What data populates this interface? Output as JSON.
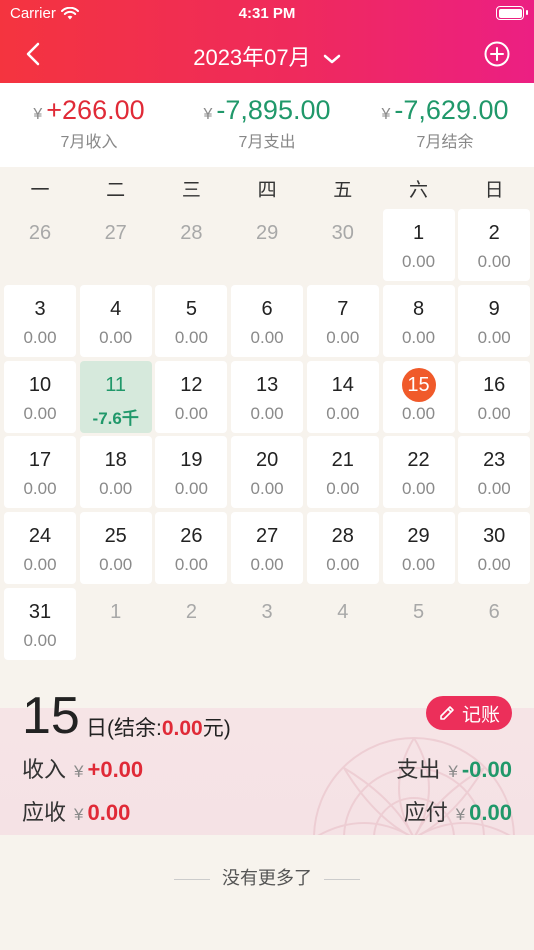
{
  "status_bar": {
    "carrier": "Carrier",
    "time": "4:31 PM"
  },
  "nav": {
    "title": "2023年07月"
  },
  "summary": {
    "currency": "¥",
    "income": {
      "value": "+266.00",
      "label": "7月收入"
    },
    "expense": {
      "value": "-7,895.00",
      "label": "7月支出"
    },
    "balance": {
      "value": "-7,629.00",
      "label": "7月结余"
    }
  },
  "calendar": {
    "weekdays": [
      "一",
      "二",
      "三",
      "四",
      "五",
      "六",
      "日"
    ],
    "days": [
      {
        "num": "26",
        "amt": "",
        "type": "other"
      },
      {
        "num": "27",
        "amt": "",
        "type": "other"
      },
      {
        "num": "28",
        "amt": "",
        "type": "other"
      },
      {
        "num": "29",
        "amt": "",
        "type": "other"
      },
      {
        "num": "30",
        "amt": "",
        "type": "other"
      },
      {
        "num": "1",
        "amt": "0.00",
        "type": "cur"
      },
      {
        "num": "2",
        "amt": "0.00",
        "type": "cur"
      },
      {
        "num": "3",
        "amt": "0.00",
        "type": "cur"
      },
      {
        "num": "4",
        "amt": "0.00",
        "type": "cur"
      },
      {
        "num": "5",
        "amt": "0.00",
        "type": "cur"
      },
      {
        "num": "6",
        "amt": "0.00",
        "type": "cur"
      },
      {
        "num": "7",
        "amt": "0.00",
        "type": "cur"
      },
      {
        "num": "8",
        "amt": "0.00",
        "type": "cur"
      },
      {
        "num": "9",
        "amt": "0.00",
        "type": "cur"
      },
      {
        "num": "10",
        "amt": "0.00",
        "type": "cur"
      },
      {
        "num": "11",
        "amt": "-7.6千",
        "type": "neg"
      },
      {
        "num": "12",
        "amt": "0.00",
        "type": "cur"
      },
      {
        "num": "13",
        "amt": "0.00",
        "type": "cur"
      },
      {
        "num": "14",
        "amt": "0.00",
        "type": "cur"
      },
      {
        "num": "15",
        "amt": "0.00",
        "type": "today"
      },
      {
        "num": "16",
        "amt": "0.00",
        "type": "cur"
      },
      {
        "num": "17",
        "amt": "0.00",
        "type": "cur"
      },
      {
        "num": "18",
        "amt": "0.00",
        "type": "cur"
      },
      {
        "num": "19",
        "amt": "0.00",
        "type": "cur"
      },
      {
        "num": "20",
        "amt": "0.00",
        "type": "cur"
      },
      {
        "num": "21",
        "amt": "0.00",
        "type": "cur"
      },
      {
        "num": "22",
        "amt": "0.00",
        "type": "cur"
      },
      {
        "num": "23",
        "amt": "0.00",
        "type": "cur"
      },
      {
        "num": "24",
        "amt": "0.00",
        "type": "cur"
      },
      {
        "num": "25",
        "amt": "0.00",
        "type": "cur"
      },
      {
        "num": "26",
        "amt": "0.00",
        "type": "cur"
      },
      {
        "num": "27",
        "amt": "0.00",
        "type": "cur"
      },
      {
        "num": "28",
        "amt": "0.00",
        "type": "cur"
      },
      {
        "num": "29",
        "amt": "0.00",
        "type": "cur"
      },
      {
        "num": "30",
        "amt": "0.00",
        "type": "cur"
      },
      {
        "num": "31",
        "amt": "0.00",
        "type": "cur"
      },
      {
        "num": "1",
        "amt": "",
        "type": "other"
      },
      {
        "num": "2",
        "amt": "",
        "type": "other"
      },
      {
        "num": "3",
        "amt": "",
        "type": "other"
      },
      {
        "num": "4",
        "amt": "",
        "type": "other"
      },
      {
        "num": "5",
        "amt": "",
        "type": "other"
      },
      {
        "num": "6",
        "amt": "",
        "type": "other"
      }
    ]
  },
  "detail": {
    "day": "15",
    "day_suffix": "日(结余:",
    "balance": "0.00",
    "balance_suffix": "元)",
    "record_label": "记账",
    "income_label": "收入",
    "income_value": "+0.00",
    "expense_label": "支出",
    "expense_value": "-0.00",
    "receivable_label": "应收",
    "receivable_value": "0.00",
    "payable_label": "应付",
    "payable_value": "0.00",
    "currency": "¥"
  },
  "footer": {
    "text": "没有更多了"
  },
  "colors": {
    "accent": "#ec2f5a",
    "income": "#e02a37",
    "expense": "#20986a",
    "today": "#f05a2a"
  }
}
